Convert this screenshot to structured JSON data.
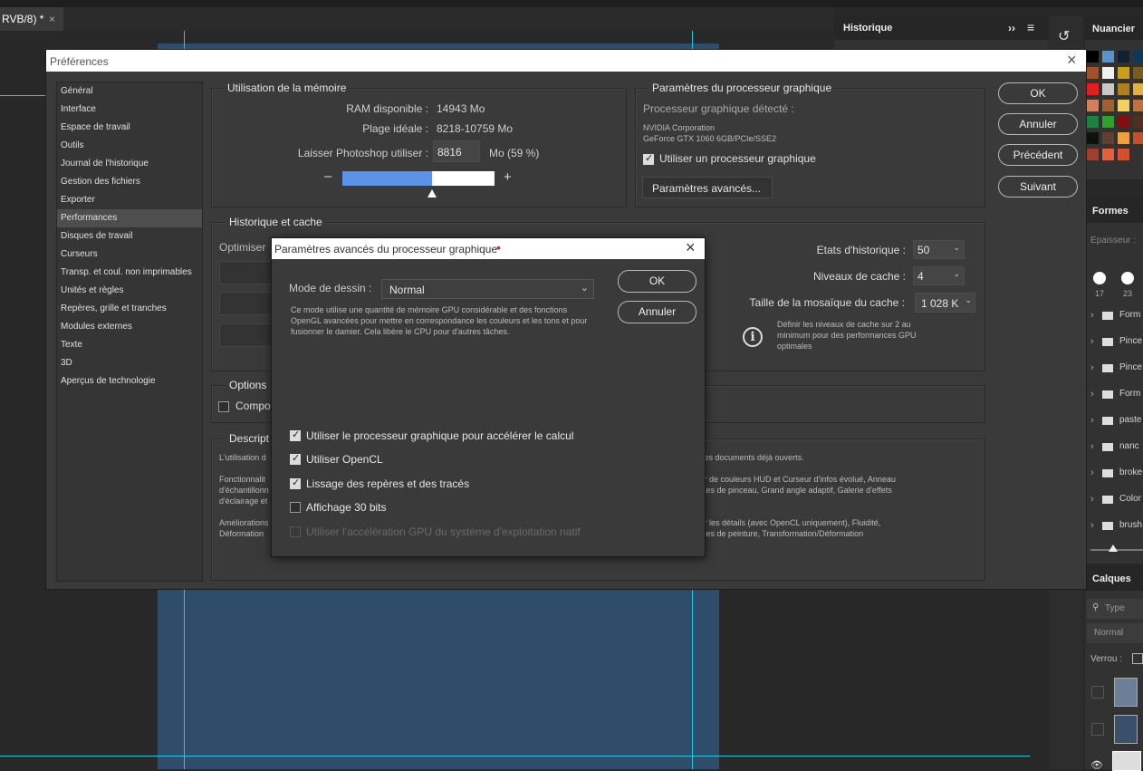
{
  "document_tab": {
    "label": "RVB/8) *",
    "close": "×"
  },
  "history_panel": {
    "title": "Historique",
    "collapse": "››",
    "menu": "≡"
  },
  "swatches_panel": {
    "title": "Nuancier"
  },
  "shapes_panel": {
    "title": "Formes",
    "size_label": "Epaisseur :",
    "brush_sizes": [
      "17",
      "23"
    ],
    "groups": [
      "Form",
      "Pince",
      "Pince",
      "Form",
      "paste",
      "nanc",
      "broke",
      "Color",
      "brush"
    ]
  },
  "layers_panel": {
    "title": "Calques",
    "search_placeholder": "Type",
    "blend_mode": "Normal",
    "lock_label": "Verrou :"
  },
  "preferences": {
    "title": "Préférences",
    "close": "×",
    "nav_items": [
      "Général",
      "Interface",
      "Espace de travail",
      "Outils",
      "Journal de l'historique",
      "Gestion des fichiers",
      "Exporter",
      "Performances",
      "Disques de travail",
      "Curseurs",
      "Transp. et coul. non imprimables",
      "Unités et règles",
      "Repères, grille et tranches",
      "Modules externes",
      "Texte",
      "3D",
      "Aperçus de technologie"
    ],
    "selected_nav": "Performances",
    "memory": {
      "title": "Utilisation de la mémoire",
      "ram_label": "RAM disponible :",
      "ram_value": "14943 Mo",
      "range_label": "Plage idéale :",
      "range_value": "8218-10759 Mo",
      "use_label": "Laisser Photoshop utiliser :",
      "use_value": "8816",
      "use_suffix": "Mo (59 %)",
      "minus": "–",
      "plus": "+",
      "slider_fraction": 0.59
    },
    "gpu": {
      "title": "Paramètres du processeur graphique",
      "detected_label": "Processeur graphique détecté :",
      "vendor": "NVIDIA Corporation",
      "model": "GeForce GTX 1060 6GB/PCIe/SSE2",
      "use_gpu_label": "Utiliser un processeur graphique",
      "advanced_button": "Paramètres avancés..."
    },
    "buttons": {
      "ok": "OK",
      "cancel": "Annuler",
      "prev": "Précédent",
      "next": "Suivant"
    },
    "history_cache": {
      "title": "Historique et cache",
      "optimise_label": "Optimiser",
      "history_states_label": "Etats d'historique :",
      "history_states_value": "50",
      "cache_levels_label": "Niveaux de cache :",
      "cache_levels_value": "4",
      "tile_size_label": "Taille de la mosaïque du cache :",
      "tile_size_value": "1 028 K",
      "info_text": "Définir les niveaux de cache sur 2 au minimum pour des performances GPU optimales"
    },
    "options": {
      "title": "Options",
      "checkbox_label": "Compo"
    },
    "description": {
      "title": "Descript",
      "line1_left": "L'utilisation d",
      "line1_right": "ur les documents déjà ouverts.",
      "p2_left": [
        "Fonctionnalit",
        "d'échantillonn",
        "d'éclairage et"
      ],
      "p2_right": [
        "teur de couleurs HUD et Curseur d'infos évolué, Anneau",
        "ointes de pinceau, Grand angle adaptif, Galerie d'effets"
      ],
      "p3_left": [
        "Améliorations",
        "Déformation"
      ],
      "p3_right": [
        "rver les détails (avec OpenCL uniquement), Fluidité,",
        "ances de peinture, Transformation/Déformation"
      ]
    }
  },
  "advanced_gpu": {
    "title": "Paramètres avancés du processeur graphique",
    "title_dot": "•",
    "close": "×",
    "mode_label": "Mode de dessin :",
    "mode_value": "Normal",
    "mode_description": "Ce mode utilise une quantité de mémoire GPU considérable et des fonctions OpenGL avancées pour mettre en correspondance les couleurs et les tons et pour fusionner le damier. Cela libère le CPU pour d'autres tâches.",
    "ok": "OK",
    "cancel": "Annuler",
    "checkboxes": [
      {
        "label": "Utiliser le processeur graphique pour accélérer le calcul",
        "checked": true,
        "disabled": false
      },
      {
        "label": "Utiliser OpenCL",
        "checked": true,
        "disabled": false
      },
      {
        "label": "Lissage des repères et des tracés",
        "checked": true,
        "disabled": false
      },
      {
        "label": "Affichage 30 bits",
        "checked": false,
        "disabled": false
      },
      {
        "label": "Utiliser l'accélération GPU du système d'exploitation natif",
        "checked": false,
        "disabled": true
      }
    ]
  },
  "colors": {
    "accent_blue": "#5b93e8",
    "guide": "#27c7e0",
    "dot": "#e02020"
  }
}
